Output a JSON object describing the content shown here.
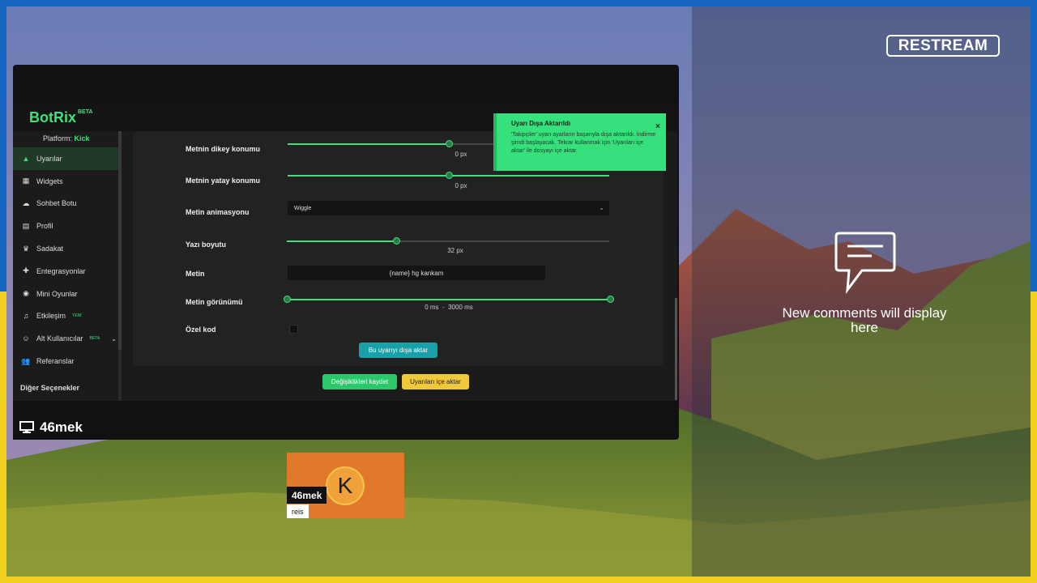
{
  "restream": {
    "logo": "RESTREAM",
    "comments_empty": "New comments will display here"
  },
  "app": {
    "logo": "BotRix",
    "logo_badge": "BETA",
    "platform_label": "Platform:",
    "platform_value": "Kick",
    "sidebar": {
      "items": [
        {
          "label": "Uyarılar",
          "icon": "warning-icon",
          "active": true
        },
        {
          "label": "Widgets",
          "icon": "grid-icon"
        },
        {
          "label": "Sohbet Botu",
          "icon": "cloud-icon"
        },
        {
          "label": "Profil",
          "icon": "id-card-icon"
        },
        {
          "label": "Sadakat",
          "icon": "trophy-icon"
        },
        {
          "label": "Entegrasyonlar",
          "icon": "puzzle-icon"
        },
        {
          "label": "Mini Oyunlar",
          "icon": "gamepad-icon"
        },
        {
          "label": "Etkileşim",
          "icon": "music-icon",
          "badge": "YENİ"
        },
        {
          "label": "Alt Kullanıcılar",
          "icon": "users-icon",
          "badge": "BETA"
        },
        {
          "label": "Referanslar",
          "icon": "people-icon"
        }
      ],
      "other": "Diğer Seçenekler"
    },
    "settings": {
      "vertical": {
        "label": "Metnin dikey konumu",
        "value": "0 px",
        "level": 0.5
      },
      "horizontal": {
        "label": "Metnin yatay konumu",
        "value": "0 px",
        "level": 0.5
      },
      "animation": {
        "label": "Metin animasyonu",
        "value": "Wiggle"
      },
      "font_size": {
        "label": "Yazı boyutu",
        "value": "32 px",
        "level": 0.34
      },
      "text": {
        "label": "Metin",
        "value": "{name} hg kankam"
      },
      "display": {
        "label": "Metin görünümü",
        "value_start": "0 ms",
        "separator": "-",
        "value_end": "3000 ms"
      },
      "custom_code": {
        "label": "Özel kod"
      }
    },
    "buttons": {
      "export": "Bu uyarıyı dışa aktar",
      "save": "Değişiklikleri kaydet",
      "import": "Uyarıları içe aktar"
    },
    "toast": {
      "title": "Uyarı Dışa Aktarıldı",
      "body": "'Takipçiler' uyarı ayarların başarıyla dışa aktarıldı. İndirme şimdi başlayacak. Tekrar kullanmak için 'Uyarıları içe aktar' ile dosyayı içe aktar.",
      "close": "×"
    }
  },
  "stream": {
    "name": "46mek"
  },
  "camera": {
    "name": "46mek",
    "subtitle": "reis",
    "avatar_letter": "K"
  },
  "colors": {
    "accent": "#3ee27a",
    "frame_blue": "#1565c0",
    "frame_yellow": "#f2d21e",
    "cam_bg": "#e07a2a"
  }
}
